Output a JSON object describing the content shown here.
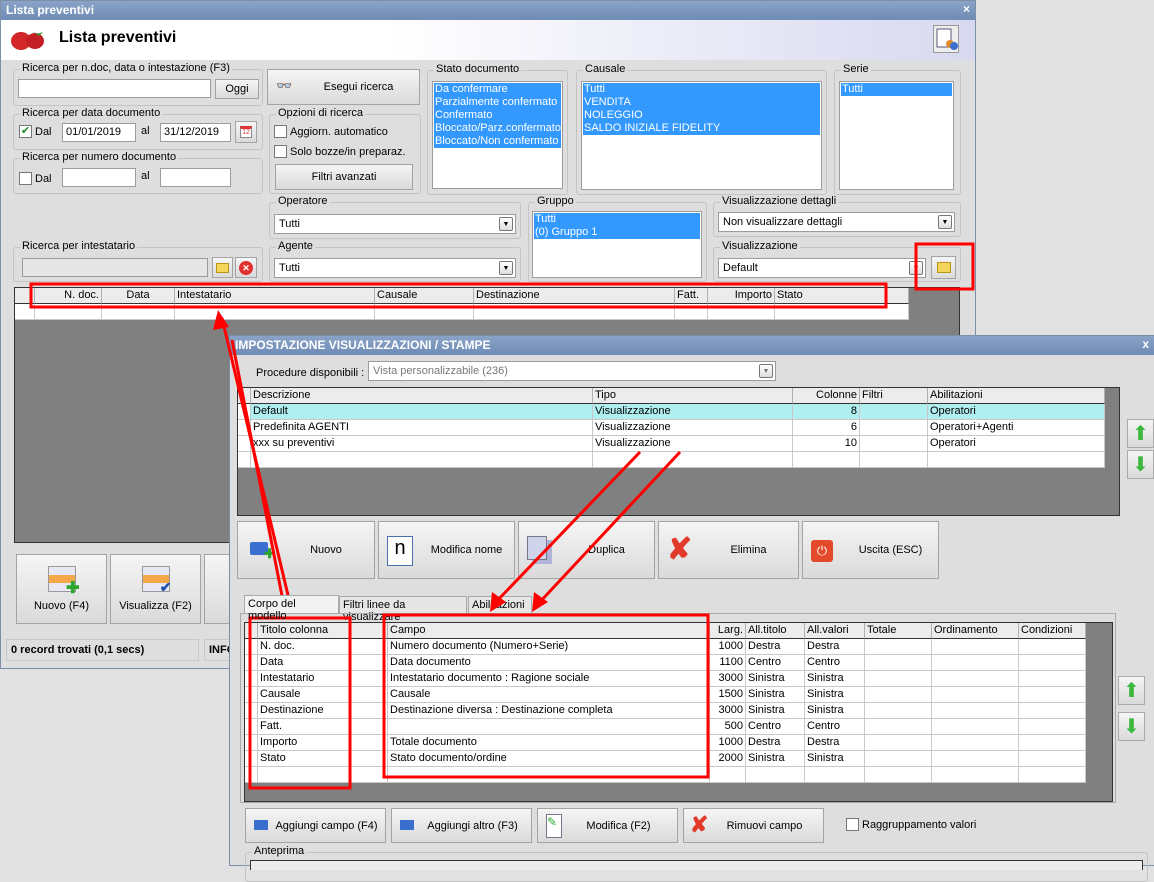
{
  "main": {
    "window_title": "Lista preventivi",
    "header_title": "Lista preventivi",
    "close": "×",
    "search_text": {
      "label": "Ricerca per n.doc, data o intestazione (F3)",
      "value": "",
      "today_button": "Oggi"
    },
    "search_button": "Esegui ricerca",
    "date_search": {
      "label": "Ricerca per data documento",
      "checked": true,
      "from_label": "Dal",
      "from": "01/01/2019",
      "to_label": "al",
      "to": "31/12/2019"
    },
    "number_search": {
      "label": "Ricerca per numero documento",
      "checked": false,
      "from_label": "Dal",
      "from": "",
      "to_label": "al",
      "to": ""
    },
    "options": {
      "label": "Opzioni di ricerca",
      "auto_update": "Aggiorn. automatico",
      "drafts_only": "Solo bozze/in preparaz.",
      "advanced_filters": "Filtri avanzati"
    },
    "stato": {
      "label": "Stato documento",
      "items": [
        "Da confermare",
        "Parzialmente confermato",
        "Confermato",
        "Bloccato/Parz.confermato",
        "Bloccato/Non confermato"
      ]
    },
    "causale": {
      "label": "Causale",
      "items": [
        "Tutti",
        "VENDITA",
        "NOLEGGIO",
        "SALDO INIZIALE FIDELITY"
      ]
    },
    "serie": {
      "label": "Serie",
      "items": [
        "Tutti"
      ]
    },
    "operatore": {
      "label": "Operatore",
      "value": "Tutti"
    },
    "agente": {
      "label": "Agente",
      "value": "Tutti"
    },
    "gruppo": {
      "label": "Gruppo",
      "items": [
        "Tutti",
        "(0) Gruppo 1"
      ]
    },
    "dettagli": {
      "label": "Visualizzazione dettagli",
      "value": "Non visualizzare dettagli"
    },
    "visualizzazione": {
      "label": "Visualizzazione",
      "value": "Default"
    },
    "intestatario": {
      "label": "Ricerca per intestatario",
      "value": ""
    },
    "grid_columns": [
      "N. doc.",
      "Data",
      "Intestatario",
      "Causale",
      "Destinazione",
      "Fatt.",
      "Importo",
      "Stato"
    ],
    "buttons": {
      "new": "Nuovo (F4)",
      "view": "Visualizza (F2)"
    },
    "status": {
      "records": "0 record trovati (0,1 secs)",
      "info": "INFO"
    }
  },
  "dialog": {
    "title": "IMPOSTAZIONE VISUALIZZAZIONI / STAMPE",
    "close": "x",
    "procedure_label": "Procedure disponibili :",
    "procedure_value": "Vista personalizzabile (236)",
    "views_columns": [
      "Descrizione",
      "Tipo",
      "Colonne",
      "Filtri",
      "Abilitazioni"
    ],
    "views_rows": [
      [
        "Default",
        "Visualizzazione",
        "8",
        "",
        "Operatori"
      ],
      [
        "Predefinita AGENTI",
        "Visualizzazione",
        "6",
        "",
        "Operatori+Agenti"
      ],
      [
        "xxx su preventivi",
        "Visualizzazione",
        "10",
        "",
        "Operatori"
      ]
    ],
    "selected_view": 0,
    "buttons": {
      "new": "Nuovo",
      "rename": "Modifica nome",
      "duplicate": "Duplica",
      "delete": "Elimina",
      "exit": "Uscita (ESC)"
    },
    "tabs": [
      "Corpo del modello",
      "Filtri linee da visualizzare",
      "Abilitazioni"
    ],
    "active_tab": 0,
    "fields_columns": [
      "Titolo colonna",
      "Campo",
      "Larg.",
      "All.titolo",
      "All.valori",
      "Totale",
      "Ordinamento",
      "Condizioni"
    ],
    "fields_rows": [
      [
        "N. doc.",
        "Numero documento (Numero+Serie)",
        "1000",
        "Destra",
        "Destra",
        "",
        "",
        ""
      ],
      [
        "Data",
        "Data documento",
        "1100",
        "Centro",
        "Centro",
        "",
        "",
        ""
      ],
      [
        "Intestatario",
        "Intestatario documento : Ragione sociale",
        "3000",
        "Sinistra",
        "Sinistra",
        "",
        "",
        ""
      ],
      [
        "Causale",
        "Causale",
        "1500",
        "Sinistra",
        "Sinistra",
        "",
        "",
        ""
      ],
      [
        "Destinazione",
        "Destinazione diversa : Destinazione completa",
        "3000",
        "Sinistra",
        "Sinistra",
        "",
        "",
        ""
      ],
      [
        "Fatt.",
        "",
        "500",
        "Centro",
        "Centro",
        "",
        "",
        ""
      ],
      [
        "Importo",
        "Totale documento",
        "1000",
        "Destra",
        "Destra",
        "",
        "",
        ""
      ],
      [
        "Stato",
        "Stato documento/ordine",
        "2000",
        "Sinistra",
        "Sinistra",
        "",
        "",
        ""
      ]
    ],
    "field_buttons": {
      "add_field": "Aggiungi campo (F4)",
      "add_other": "Aggiungi altro (F3)",
      "edit": "Modifica (F2)",
      "remove": "Rimuovi campo"
    },
    "group_values": {
      "label": "Raggruppamento valori",
      "checked": false
    },
    "preview_label": "Anteprima"
  },
  "colors": {
    "annotation": "#ff0000",
    "selection": "#3399ff",
    "selected_row": "#b0eef0"
  }
}
